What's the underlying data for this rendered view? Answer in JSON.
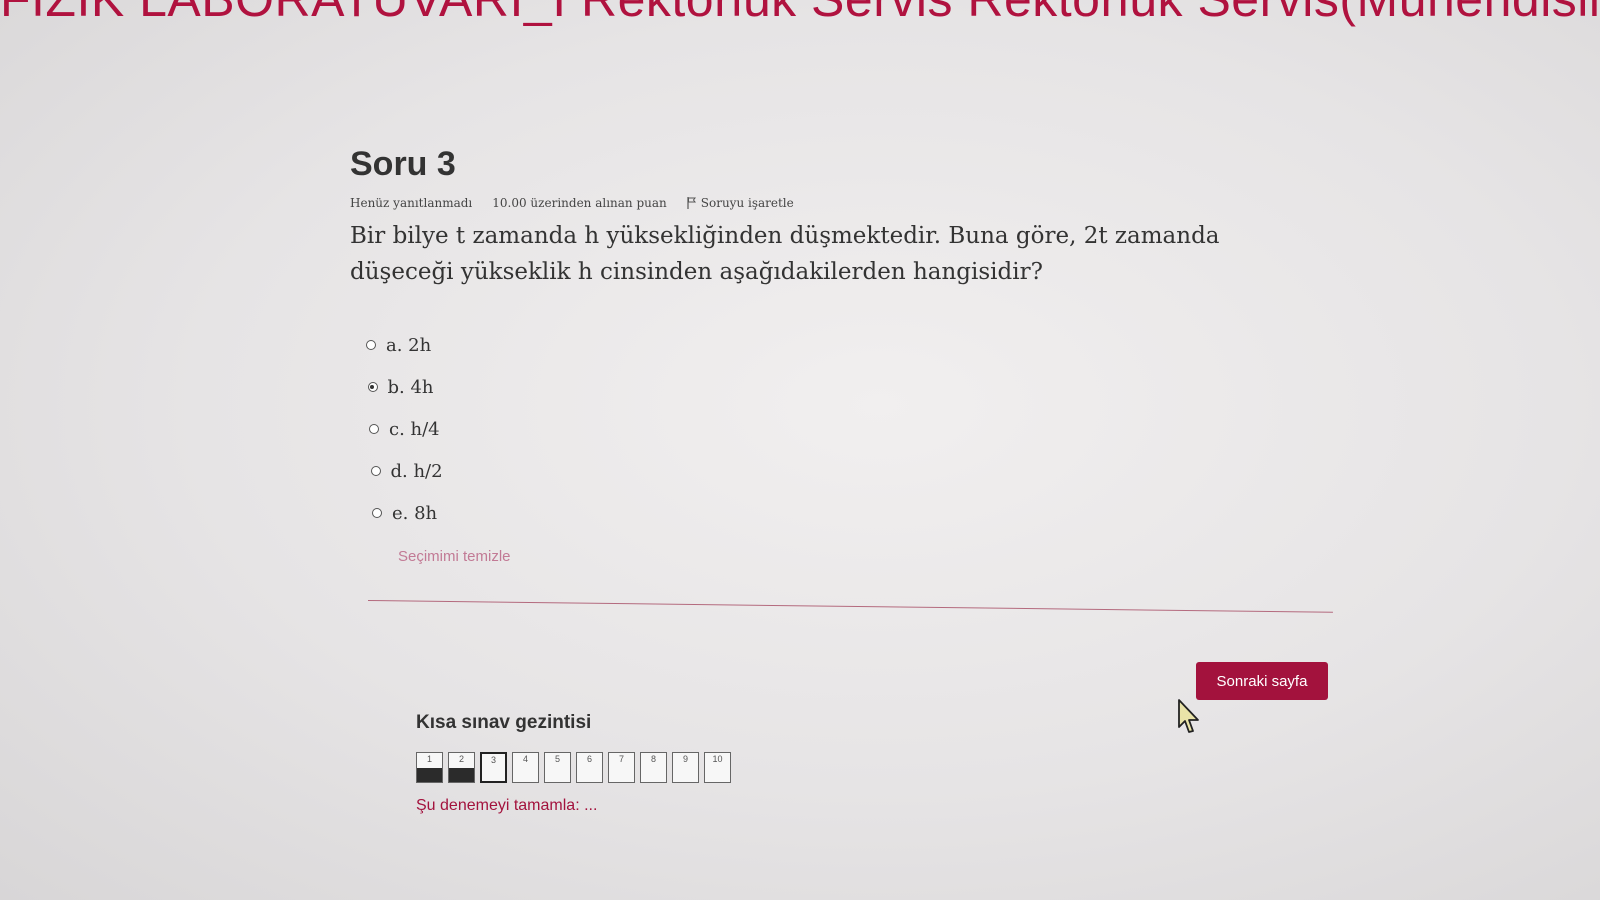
{
  "banner": {
    "text": "FİZİK LABORATUVARI_I Rektörlük Servis Rektörlük Servis(Mühendislik)"
  },
  "question": {
    "title": "Soru 3",
    "status": "Henüz yanıtlanmadı",
    "points": "10.00 üzerinden alınan puan",
    "flag_label": "Soruyu işaretle",
    "text": "Bir bilye t zamanda h yüksekliğinden düşmektedir. Buna göre, 2t zamanda düşeceği yükseklik h cinsinden aşağıdakilerden hangisidir?",
    "options": [
      {
        "label": "a. 2h",
        "selected": false
      },
      {
        "label": "b. 4h",
        "selected": true
      },
      {
        "label": "c. h/4",
        "selected": false
      },
      {
        "label": "d. h/2",
        "selected": false
      },
      {
        "label": "e. 8h",
        "selected": false
      }
    ],
    "clear_label": "Seçimimi temizle"
  },
  "next_button": {
    "label": "Sonraki sayfa"
  },
  "quiz_nav": {
    "title": "Kısa sınav gezintisi",
    "cells": [
      {
        "label": "1",
        "state": "answered"
      },
      {
        "label": "2",
        "state": "answered"
      },
      {
        "label": "3",
        "state": "current"
      },
      {
        "label": "4",
        "state": ""
      },
      {
        "label": "5",
        "state": ""
      },
      {
        "label": "6",
        "state": ""
      },
      {
        "label": "7",
        "state": ""
      },
      {
        "label": "8",
        "state": ""
      },
      {
        "label": "9",
        "state": ""
      },
      {
        "label": "10",
        "state": ""
      }
    ],
    "finish_label": "Şu denemeyi tamamla: ..."
  },
  "colors": {
    "accent": "#a3123d",
    "link": "#c27a95"
  }
}
